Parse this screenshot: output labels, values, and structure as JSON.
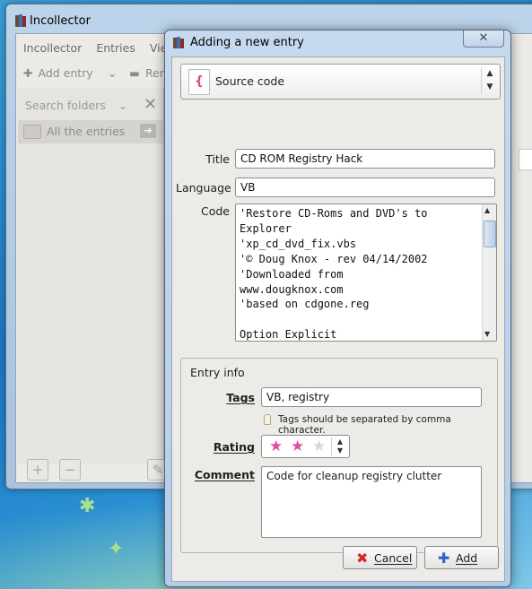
{
  "background_window": {
    "title": "Incollector",
    "menu": [
      "Incollector",
      "Entries",
      "View"
    ],
    "toolbar": {
      "add_entry": "Add entry",
      "remove": "Remov"
    },
    "sidebar": {
      "search_placeholder": "Search folders",
      "all_entries": "All the entries"
    }
  },
  "dialog": {
    "title": "Adding a new entry",
    "type_selector": {
      "value": "Source code",
      "icon_glyph": "{"
    },
    "labels": {
      "title": "Title",
      "language": "Language",
      "code": "Code"
    },
    "fields": {
      "title": "CD ROM Registry Hack",
      "language": "VB",
      "code": "'Restore CD-Roms and DVD's to\nExplorer\n'xp_cd_dvd_fix.vbs\n'© Doug Knox - rev 04/14/2002\n'Downloaded from\nwww.dougknox.com\n'based on cdgone.reg\n\nOption Explicit"
    },
    "entry_info": {
      "group_title": "Entry info",
      "tags_label": "Tags",
      "tags_value": "VB, registry",
      "tags_hint": "Tags should be separated by comma character.",
      "rating_label": "Rating",
      "rating_value": 2,
      "rating_max": 3,
      "comment_label": "Comment",
      "comment_value": "Code for cleanup registry clutter"
    },
    "buttons": {
      "cancel": "Cancel",
      "add": "Add"
    },
    "colors": {
      "star_on": "#e04ba6",
      "star_off": "#d6d6d6",
      "cancel_icon": "#d52a2a",
      "add_icon": "#2c63c7"
    }
  }
}
